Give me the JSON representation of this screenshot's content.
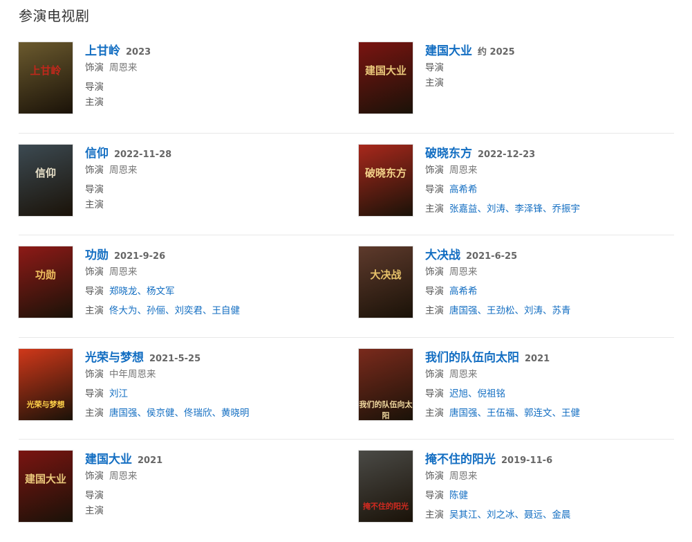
{
  "section": {
    "title": "参演电视剧"
  },
  "labels": {
    "role": "饰演",
    "director": "导演",
    "cast": "主演"
  },
  "cards": [
    {
      "title": "上甘岭",
      "date": "2023",
      "role": "周恩来",
      "director": "",
      "cast": "",
      "poster_text": "上甘岭",
      "poster_bg": "#6b5a2e",
      "poster_fg": "#c0281c"
    },
    {
      "title": "建国大业",
      "date": "约 2025",
      "role": "",
      "director": "",
      "cast": "",
      "poster_text": "建国大业",
      "poster_bg": "#7a1411",
      "poster_fg": "#e9c77a"
    },
    {
      "title": "信仰",
      "date": "2022-11-28",
      "role": "周恩来",
      "director": "",
      "cast": "",
      "poster_text": "信仰",
      "poster_bg": "#3c4a52",
      "poster_fg": "#e8e0c8"
    },
    {
      "title": "破晓东方",
      "date": "2022-12-23",
      "role": "周恩来",
      "director": "高希希",
      "cast": "张嘉益、刘涛、李泽锋、乔振宇",
      "poster_text": "破晓东方",
      "poster_bg": "#a8281c",
      "poster_fg": "#f3d38a"
    },
    {
      "title": "功勋",
      "date": "2021-9-26",
      "role": "周恩来",
      "director": "郑晓龙、杨文军",
      "cast": "佟大为、孙俪、刘奕君、王自健",
      "poster_text": "功勋",
      "poster_bg": "#8e1a17",
      "poster_fg": "#f0c060"
    },
    {
      "title": "大决战",
      "date": "2021-6-25",
      "role": "周恩来",
      "director": "高希希",
      "cast": "唐国强、王劲松、刘涛、苏青",
      "poster_text": "大决战",
      "poster_bg": "#5e3a2c",
      "poster_fg": "#e7c26a"
    },
    {
      "title": "光荣与梦想",
      "date": "2021-5-25",
      "role": "中年周恩来",
      "director": "刘江",
      "cast": "唐国强、侯京健、佟瑞欣、黄晓明",
      "poster_text": "光荣与梦想",
      "poster_bg": "#d0381a",
      "poster_fg": "#ffd24a"
    },
    {
      "title": "我们的队伍向太阳",
      "date": "2021",
      "role": "周恩来",
      "director": "迟旭、倪祖铭",
      "cast": "唐国强、王伍福、郭连文、王健",
      "poster_text": "我们的队伍向太阳",
      "poster_bg": "#7a2a1c",
      "poster_fg": "#f1d9a0"
    },
    {
      "title": "建国大业",
      "date": "2021",
      "role": "周恩来",
      "director": "",
      "cast": "",
      "poster_text": "建国大业",
      "poster_bg": "#7a1411",
      "poster_fg": "#e9c77a"
    },
    {
      "title": "掩不住的阳光",
      "date": "2019-11-6",
      "role": "周恩来",
      "director": "陈健",
      "cast": "吴其江、刘之冰、聂远、金晨",
      "poster_text": "掩不住的阳光",
      "poster_bg": "#4a4a46",
      "poster_fg": "#d02a20"
    }
  ]
}
